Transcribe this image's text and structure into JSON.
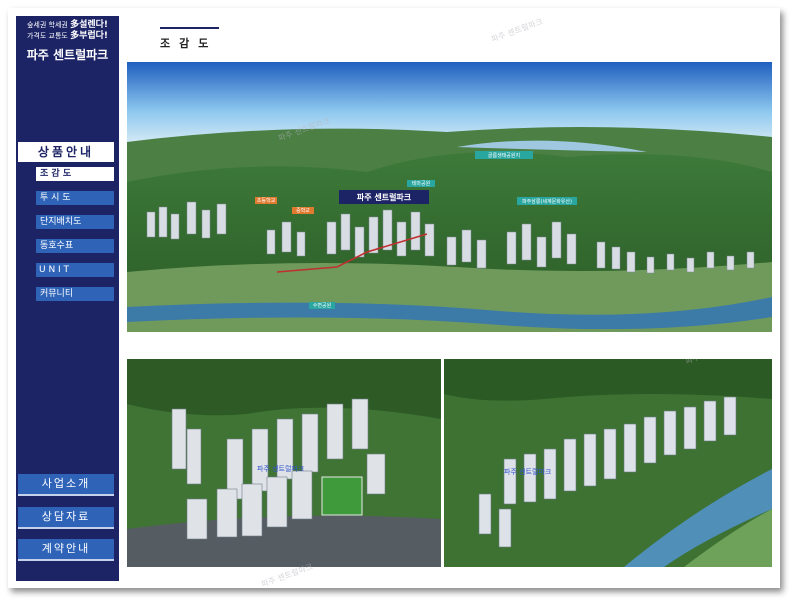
{
  "sidebar": {
    "slogan_line1_small": "숲세권 학세권",
    "slogan_line1_big": "多설렌다!",
    "slogan_line2_small": "가격도 교통도",
    "slogan_line2_big": "多부럽다!",
    "brand": "파주 센트럴파크",
    "section_header": "상품안내",
    "menu": [
      {
        "label": "조 감 도"
      },
      {
        "label": "투 시 도"
      },
      {
        "label": "단지배치도"
      },
      {
        "label": "동호수표"
      },
      {
        "label": "U N I T"
      },
      {
        "label": "커뮤니티"
      }
    ],
    "buttons": [
      {
        "label": "사업소개"
      },
      {
        "label": "상담자료"
      },
      {
        "label": "계약안내"
      }
    ]
  },
  "page": {
    "title": "조감도",
    "watermark": "파주 센트럴파크",
    "image_labels": {
      "top_brand": "파주 센트럴파크",
      "lbl_park": "골름생태공원지",
      "lbl_park2": "테마공원",
      "lbl_heritage": "파주삼릉(세계문화유산)",
      "lbl_river": "수변공원",
      "lbl_school": "초등학교",
      "lbl_middle": "중학교"
    },
    "bottom_left_label": "파주 센트럴파크",
    "bottom_right_label": "파주 센트럴파크"
  }
}
